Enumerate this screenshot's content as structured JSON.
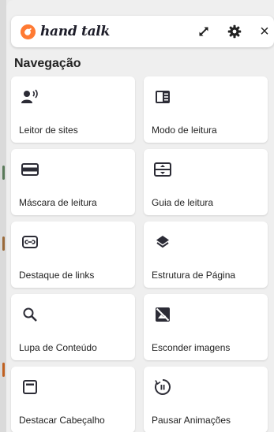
{
  "app": {
    "logo_text": "hand talk"
  },
  "header": {
    "icons": [
      "expand-icon",
      "settings-icon",
      "close-icon"
    ],
    "close_label": "×"
  },
  "section": {
    "title": "Navegação"
  },
  "features": [
    {
      "label": "Leitor de sites",
      "icon": "speaker-person-icon"
    },
    {
      "label": "Modo de leitura",
      "icon": "reading-mode-icon"
    },
    {
      "label": "Máscara de leitura",
      "icon": "reading-mask-icon"
    },
    {
      "label": "Guia de leitura",
      "icon": "reading-guide-icon"
    },
    {
      "label": "Destaque de links",
      "icon": "link-icon"
    },
    {
      "label": "Estrutura de Página",
      "icon": "layers-icon"
    },
    {
      "label": "Lupa de Conteúdo",
      "icon": "magnifier-icon"
    },
    {
      "label": "Esconder imagens",
      "icon": "hide-image-icon"
    },
    {
      "label": "Destacar Cabeçalho",
      "icon": "header-highlight-icon"
    },
    {
      "label": "Pausar Animações",
      "icon": "pause-animation-icon"
    }
  ],
  "colors": {
    "brand": "#ff7a33",
    "icon": "#2c2c36",
    "card": "#ffffff",
    "background": "#efefef"
  }
}
